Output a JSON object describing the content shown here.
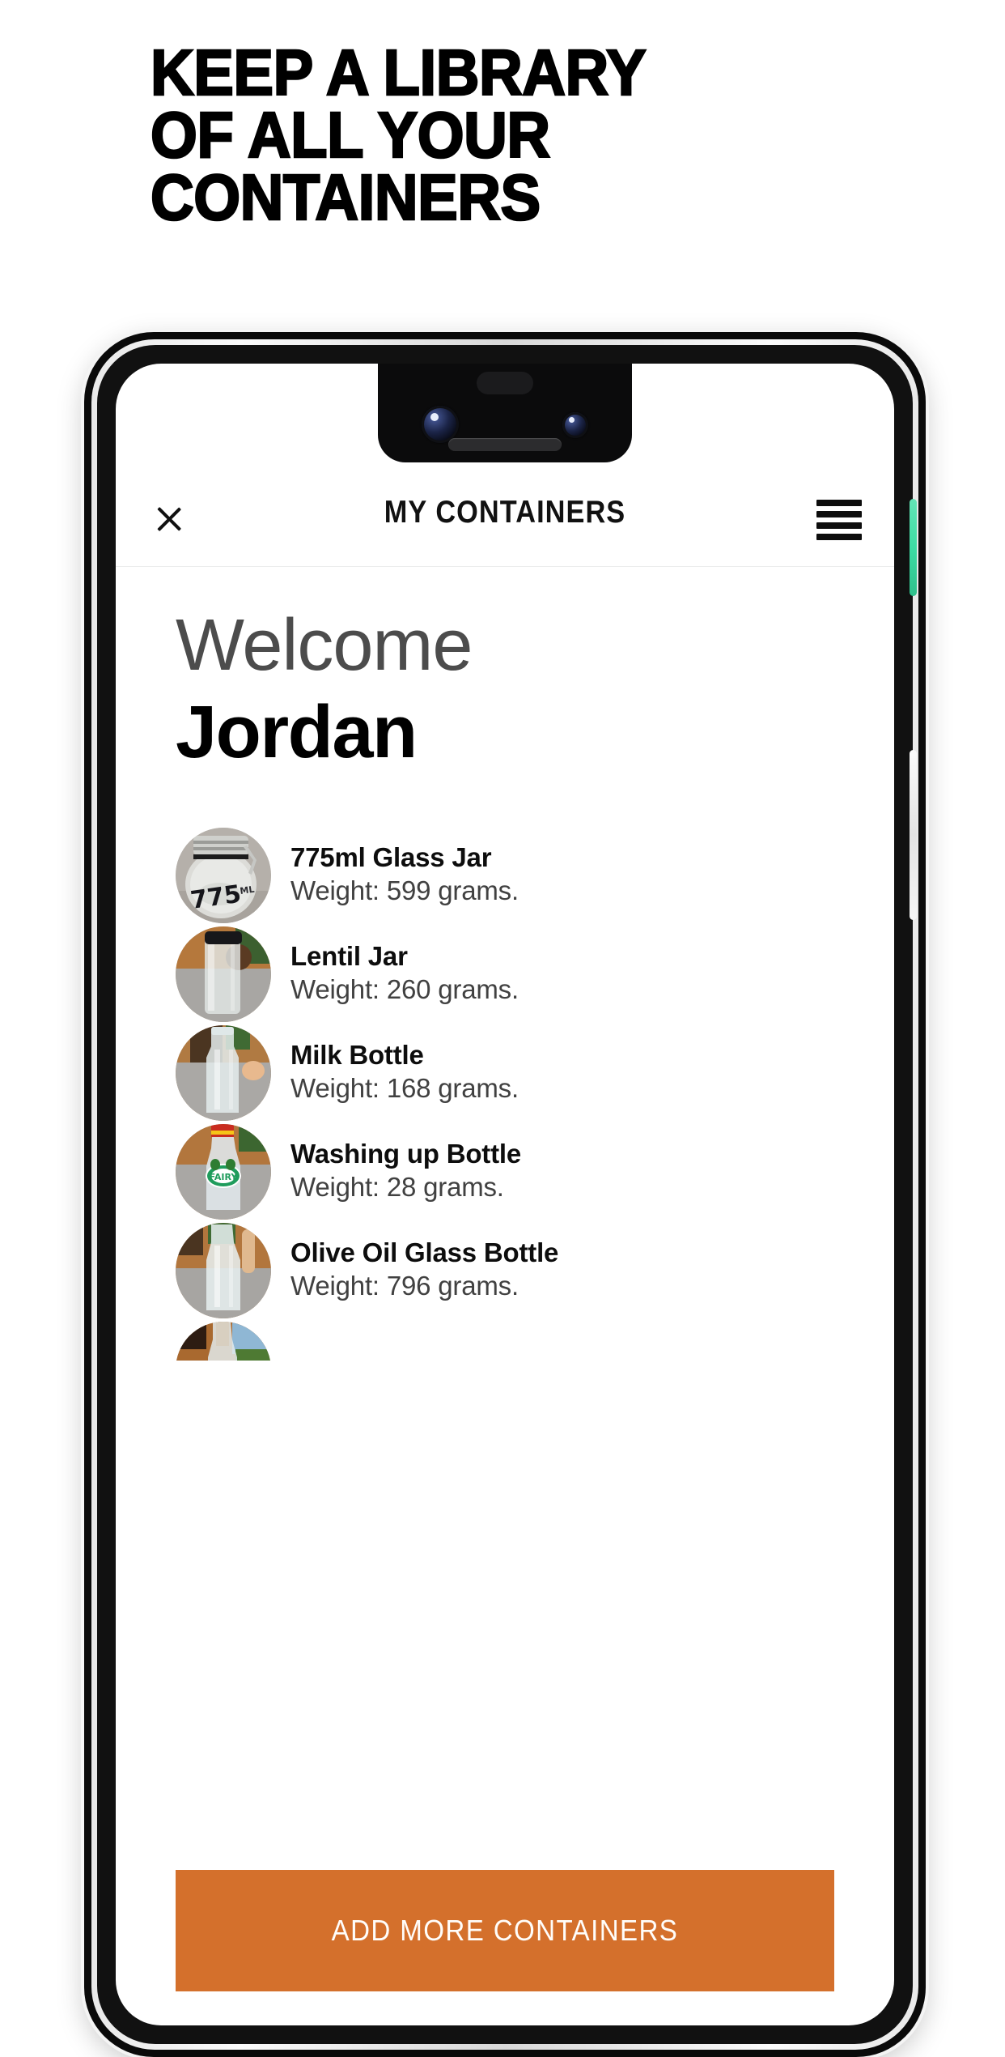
{
  "headline": {
    "lines": [
      "KEEP A LIBRARY",
      "OF ALL YOUR",
      "CONTAINERS"
    ]
  },
  "colors": {
    "accent_orange": "#d4702c",
    "power_button_green": "#3ddca4",
    "title_text": "#111111",
    "welcome_gray": "#4c4c4c",
    "weight_gray": "#414141"
  },
  "device": {
    "notch_icons": [
      "front-camera-main",
      "front-camera-secondary",
      "proximity-sensor",
      "earpiece-speaker"
    ],
    "side_buttons": [
      "power-button",
      "volume-rocker"
    ]
  },
  "app": {
    "header": {
      "close_icon": "close-icon",
      "title": "MY CONTAINERS",
      "menu_icon": "hamburger-menu-icon"
    },
    "welcome": {
      "greeting": "Welcome",
      "name": "Jordan"
    },
    "containers": [
      {
        "name": "775ml Glass Jar",
        "weight": "Weight: 599 grams.",
        "thumb": "glass-jar-775ml-photo"
      },
      {
        "name": "Lentil Jar",
        "weight": "Weight: 260 grams.",
        "thumb": "lentil-jar-photo"
      },
      {
        "name": "Milk Bottle",
        "weight": "Weight: 168 grams.",
        "thumb": "milk-bottle-photo"
      },
      {
        "name": "Washing up Bottle",
        "weight": "Weight: 28 grams.",
        "thumb": "washing-up-bottle-photo"
      },
      {
        "name": "Olive Oil Glass Bottle",
        "weight": "Weight: 796 grams.",
        "thumb": "olive-oil-bottle-photo"
      },
      {
        "name": "",
        "weight": "",
        "thumb": "partial-bottle-photo"
      }
    ],
    "cta": {
      "label": "ADD MORE CONTAINERS"
    }
  }
}
